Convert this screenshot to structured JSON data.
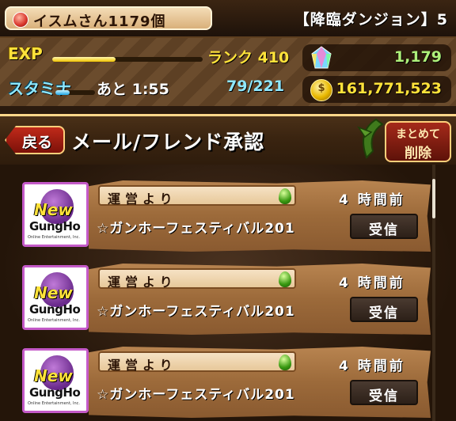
{
  "header": {
    "player_name": "イスムさん1179個",
    "dungeon_name": "【降臨ダンジョン】5"
  },
  "stats": {
    "exp_label": "EXP",
    "exp_progress": 0.42,
    "rank_text": "ランク 410",
    "stamina_label": "スタミナ",
    "stamina_progress": 0.36,
    "stamina_timer": "あと 1:55",
    "stamina_value": "79/221",
    "magic_stones": "1,179",
    "coins": "161,771,523",
    "coin_glyph": "$"
  },
  "titlebar": {
    "back_label": "戻る",
    "title": "メール/フレンド承認",
    "delete_all_line1": "まとめて",
    "delete_all_line2": "削除"
  },
  "avatar": {
    "logo_new": "New",
    "logo_brand": "GungHo",
    "logo_sub": "Online Entertainment, Inc."
  },
  "mails": [
    {
      "sender": "運営より",
      "time": "4 時間前",
      "subject": "☆ガンホーフェスティバル201",
      "action": "受信"
    },
    {
      "sender": "運営より",
      "time": "4 時間前",
      "subject": "☆ガンホーフェスティバル201",
      "action": "受信"
    },
    {
      "sender": "運営より",
      "time": "4 時間前",
      "subject": "☆ガンホーフェスティバル201",
      "action": "受信"
    }
  ],
  "colors": {
    "accent_yellow": "#ffe23a",
    "stamina_blue": "#8fe8ff",
    "stone_green": "#aef07a",
    "button_red": "#a52a1a",
    "avatar_border": "#c45ac8"
  },
  "icons": {
    "stone": "magic-stone-icon",
    "coin": "coin-icon",
    "egg": "green-egg-icon",
    "orb": "red-orb-icon"
  }
}
